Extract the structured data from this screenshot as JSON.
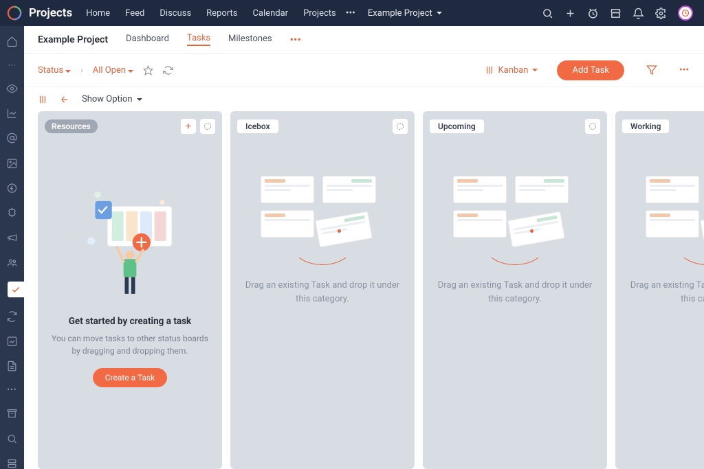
{
  "topbar": {
    "brand": "Projects",
    "nav": [
      "Home",
      "Feed",
      "Discuss",
      "Reports",
      "Calendar",
      "Projects"
    ],
    "project_select": "Example Project"
  },
  "subheader": {
    "project": "Example Project",
    "tabs": [
      "Dashboard",
      "Tasks",
      "Milestones"
    ],
    "active_tab": "Tasks"
  },
  "filterbar": {
    "status": "Status",
    "allopen": "All Open",
    "view": "Kanban",
    "addtask": "Add Task"
  },
  "optionbar": {
    "showopt": "Show Option"
  },
  "columns": [
    {
      "title": "Resources",
      "style": "pill"
    },
    {
      "title": "Icebox",
      "style": "plain"
    },
    {
      "title": "Upcoming",
      "style": "plain"
    },
    {
      "title": "Working",
      "style": "plain"
    }
  ],
  "firstcol": {
    "heading": "Get started by creating a task",
    "para": "You can move tasks to other status boards by dragging and dropping them.",
    "cta": "Create a Task"
  },
  "empty": {
    "text": "Drag an existing Task and drop it under this category."
  }
}
